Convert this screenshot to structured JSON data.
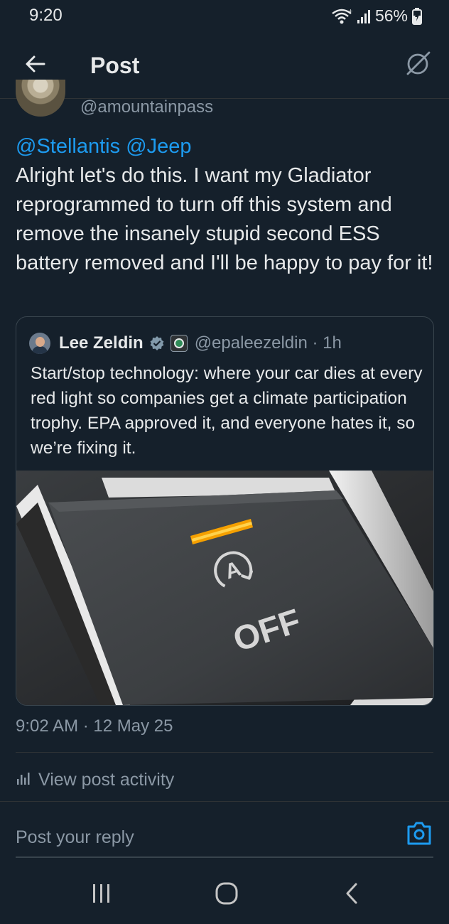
{
  "status_bar": {
    "time": "9:20",
    "battery": "56%"
  },
  "header": {
    "title": "Post",
    "icons": [
      "back-arrow-icon",
      "grok-icon"
    ]
  },
  "post": {
    "author_handle": "@amountainpass",
    "mentions": [
      "@Stellantis",
      "@Jeep"
    ],
    "body": "Alright let's do this. I want my Gladiator reprogrammed to turn off this system and remove the insanely stupid second ESS battery removed and I'll be happy to pay for it!",
    "timestamp": "9:02 AM · 12 May 25"
  },
  "quote": {
    "name": "Lee Zeldin",
    "handle_time": "@epaleezeldin · 1h",
    "text": "Start/stop technology: where your car dies at every red light so companies get a climate participation trophy. EPA approved it, and everyone hates it, so we’re fixing it.",
    "image_button_text": "OFF",
    "image_button_icon": "auto-start-stop-icon",
    "indicator_color": "#f5a000"
  },
  "actions": {
    "view_activity": "View post activity",
    "reply_placeholder": "Post your reply"
  },
  "colors": {
    "background": "#15202b",
    "accent": "#1d9bf0",
    "secondary_text": "#8b98a5"
  }
}
